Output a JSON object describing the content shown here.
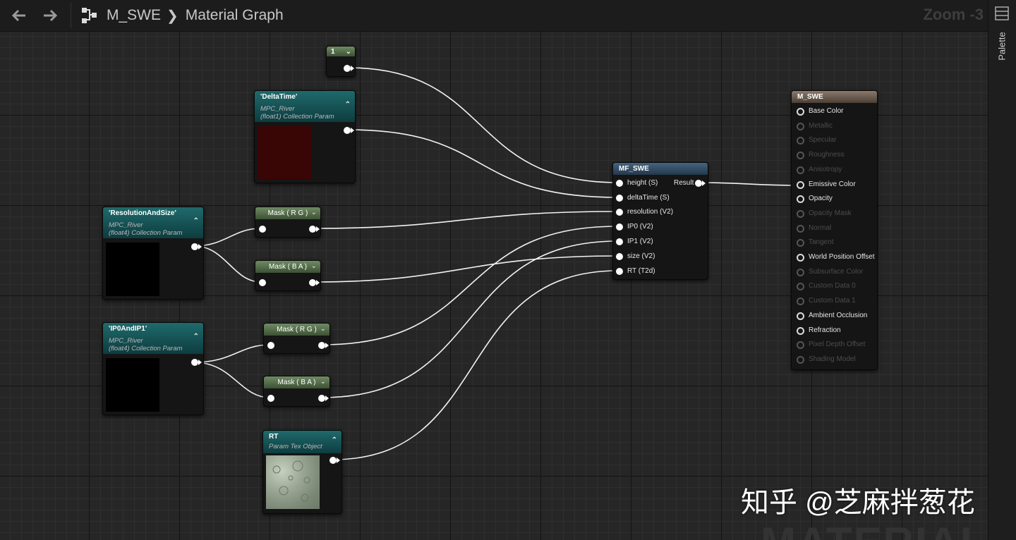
{
  "toolbar": {
    "breadcrumb": [
      "M_SWE",
      "Material Graph"
    ],
    "zoom": "Zoom -3"
  },
  "right_panel": {
    "palette_label": "Palette"
  },
  "nodes": {
    "const1": {
      "value": "1"
    },
    "deltatime": {
      "title": "'DeltaTime'",
      "collection": "MPC_River",
      "type": "(float1) Collection Param",
      "swatch_color": "#3a0505"
    },
    "resolution": {
      "title": "'ResolutionAndSize'",
      "collection": "MPC_River",
      "type": "(float4) Collection Param",
      "swatch_color": "#000000"
    },
    "ip0andip1": {
      "title": "'IP0AndIP1'",
      "collection": "MPC_River",
      "type": "(float4) Collection Param",
      "swatch_color": "#000000"
    },
    "mask1": {
      "title": "Mask ( R G )"
    },
    "mask2": {
      "title": "Mask ( B A )"
    },
    "mask3": {
      "title": "Mask ( R G )"
    },
    "mask4": {
      "title": "Mask ( B A )"
    },
    "rt": {
      "title": "RT",
      "type": "Param Tex Object"
    },
    "mf_swe": {
      "title": "MF_SWE",
      "inputs": [
        "height (S)",
        "deltaTime (S)",
        "resolution (V2)",
        "IP0 (V2)",
        "IP1 (V2)",
        "size (V2)",
        "RT (T2d)"
      ],
      "output": "Result"
    },
    "m_swe": {
      "title": "M_SWE",
      "pins": [
        {
          "label": "Base Color",
          "active": true
        },
        {
          "label": "Metallic",
          "active": false
        },
        {
          "label": "Specular",
          "active": false
        },
        {
          "label": "Roughness",
          "active": false
        },
        {
          "label": "Anisotropy",
          "active": false
        },
        {
          "label": "Emissive Color",
          "active": true
        },
        {
          "label": "Opacity",
          "active": true
        },
        {
          "label": "Opacity Mask",
          "active": false
        },
        {
          "label": "Normal",
          "active": false
        },
        {
          "label": "Tangent",
          "active": false
        },
        {
          "label": "World Position Offset",
          "active": true
        },
        {
          "label": "Subsurface Color",
          "active": false
        },
        {
          "label": "Custom Data 0",
          "active": false
        },
        {
          "label": "Custom Data 1",
          "active": false
        },
        {
          "label": "Ambient Occlusion",
          "active": true
        },
        {
          "label": "Refraction",
          "active": true
        },
        {
          "label": "Pixel Depth Offset",
          "active": false
        },
        {
          "label": "Shading Model",
          "active": false
        }
      ]
    }
  },
  "watermark": {
    "domain_text": "MATERIAL",
    "attribution": "知乎 @芝麻拌葱花"
  },
  "colors": {
    "canvas_bg": "#262626",
    "wire": "#f2f2f2",
    "param_header": "#1f6a6c",
    "mask_header": "#6f8b64",
    "function_header": "#45647e",
    "result_header": "#8b7a6b"
  }
}
